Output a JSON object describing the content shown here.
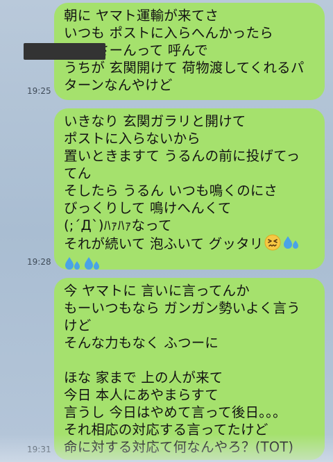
{
  "messages": [
    {
      "time": "19:25",
      "lines": [
        "朝に ヤマト運輸が来てさ",
        "いつも ポストに入らへんかったら",
        "　　 さーんって 呼んで",
        "うちが 玄関開けて 荷物渡してくれるパ",
        "ターンなんやけど"
      ]
    },
    {
      "time": "19:28",
      "lines": [
        "いきなり 玄関ガラリと開けて",
        "ポストに入らないから",
        "置いときますて うるんの前に投げてっ",
        "てん",
        "そしたら うるん いつも鳴くのにさ",
        "びっくりして 鳴けへんくて",
        "(;´Д`)ﾊｧﾊｧなって",
        "それが続いて 泡ふいて グッタリ"
      ],
      "emoji_names": [
        "persevering-face-emoji",
        "sweat-droplets-emoji",
        "sweat-droplets-emoji",
        "sweat-droplets-emoji"
      ]
    },
    {
      "time": "19:31",
      "lines": [
        "今 ヤマトに 言いに言ってんか",
        "もーいつもなら ガンガン勢いよく言う",
        "けど",
        "そんな力もなく ふつーに",
        "",
        "ほな 家まで 上の人が来て",
        "今日 本人にあやまらすて",
        "言うし 今日はやめて言って後日。。。",
        "それ相応の対応する言ってたけど",
        "命に対する対応て何なんやろ？(TOT)"
      ]
    }
  ],
  "colors": {
    "bubble": "#a5e16d",
    "background": "#b3c5d8",
    "redaction": "#333333"
  }
}
